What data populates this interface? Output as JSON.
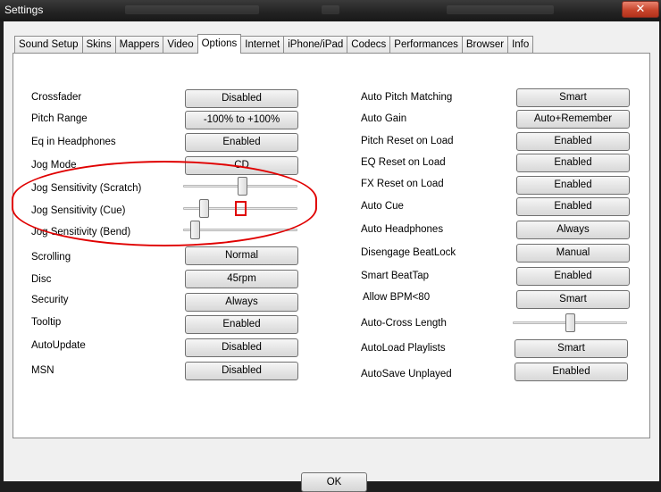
{
  "window": {
    "title": "Settings",
    "close_label": "✕"
  },
  "tabs": [
    {
      "label": "Sound Setup"
    },
    {
      "label": "Skins"
    },
    {
      "label": "Mappers"
    },
    {
      "label": "Video"
    },
    {
      "label": "Options",
      "active": true
    },
    {
      "label": "Internet"
    },
    {
      "label": "iPhone/iPad"
    },
    {
      "label": "Codecs"
    },
    {
      "label": "Performances"
    },
    {
      "label": "Browser"
    },
    {
      "label": "Info"
    }
  ],
  "left": {
    "crossfader": {
      "label": "Crossfader",
      "value": "Disabled"
    },
    "pitch_range": {
      "label": "Pitch Range",
      "value": "-100% to +100%"
    },
    "eq_headphones": {
      "label": "Eq in Headphones",
      "value": "Enabled"
    },
    "jog_mode": {
      "label": "Jog Mode",
      "value": "CD"
    },
    "jog_scratch": {
      "label": "Jog Sensitivity (Scratch)",
      "level": 0.52
    },
    "jog_cue": {
      "label": "Jog Sensitivity (Cue)",
      "level": 0.15
    },
    "jog_bend": {
      "label": "Jog Sensitivity (Bend)",
      "level": 0.07
    },
    "scrolling": {
      "label": "Scrolling",
      "value": "Normal"
    },
    "disc": {
      "label": "Disc",
      "value": "45rpm"
    },
    "security": {
      "label": "Security",
      "value": "Always"
    },
    "tooltip": {
      "label": "Tooltip",
      "value": "Enabled"
    },
    "autoupdate": {
      "label": "AutoUpdate",
      "value": "Disabled"
    },
    "msn": {
      "label": "MSN",
      "value": "Disabled"
    }
  },
  "right": {
    "auto_pitch_matching": {
      "label": "Auto Pitch Matching",
      "value": "Smart"
    },
    "auto_gain": {
      "label": "Auto Gain",
      "value": "Auto+Remember"
    },
    "pitch_reset": {
      "label": "Pitch Reset on Load",
      "value": "Enabled"
    },
    "eq_reset": {
      "label": "EQ Reset on Load",
      "value": "Enabled"
    },
    "fx_reset": {
      "label": "FX Reset on Load",
      "value": "Enabled"
    },
    "auto_cue": {
      "label": "Auto Cue",
      "value": "Enabled"
    },
    "auto_headphones": {
      "label": "Auto Headphones",
      "value": "Always"
    },
    "disengage_beatlock": {
      "label": "Disengage BeatLock",
      "value": "Manual"
    },
    "smart_beattap": {
      "label": "Smart BeatTap",
      "value": "Enabled"
    },
    "allow_bpm": {
      "label": "Allow BPM<80",
      "value": "Smart"
    },
    "auto_cross_length": {
      "label": "Auto-Cross Length",
      "level": 0.5
    },
    "autoload_playlists": {
      "label": "AutoLoad Playlists",
      "value": "Smart"
    },
    "autosave_unplayed": {
      "label": "AutoSave Unplayed",
      "value": "Enabled"
    }
  },
  "footer": {
    "ok_label": "OK"
  },
  "colors": {
    "annotation": "#e00000",
    "titlebar": "#222222",
    "close": "#c8452c"
  }
}
